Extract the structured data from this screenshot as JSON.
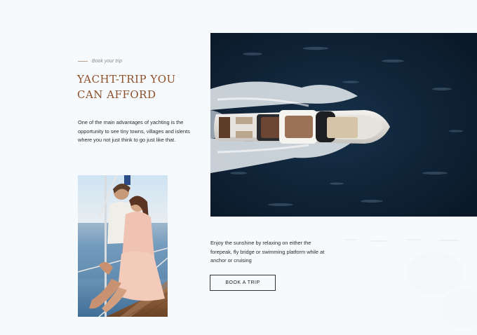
{
  "section": {
    "eyebrow": "Book your trip",
    "title_line1": "YACHT-TRIP YOU",
    "title_line2": "CAN AFFORD",
    "intro": "One of the main advantages of yachting is the opportunity to see tiny towns, villages and islents where you not just think to go just like that.",
    "description": "Enjoy the sunshine by relaxing on either the forepeak, fly bridge or swimming platform while at anchor or cruising",
    "cta_label": "BOOK A TRIP"
  },
  "colors": {
    "accent": "#8d4f2a",
    "background": "#f7fafc",
    "sea": "#0b1b2c"
  },
  "icons": []
}
